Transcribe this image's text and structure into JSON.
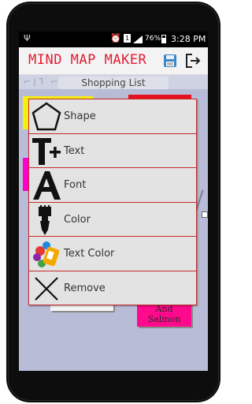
{
  "status_bar": {
    "usb_icon": "usb-icon",
    "alarm_icon": "alarm-icon",
    "sim_label": "1",
    "battery_percent": "76%",
    "time": "3:28 PM"
  },
  "header": {
    "title": "MIND MAP MAKER",
    "save_icon": "save-icon",
    "exit_icon": "exit-icon",
    "title_color": "#e21b33"
  },
  "map": {
    "list_title": "Shopping List",
    "salmon_node_text": "And\nSalmon"
  },
  "menu": {
    "items": [
      {
        "label": "Shape",
        "icon": "pentagon-icon"
      },
      {
        "label": "Text",
        "icon": "text-plus-icon"
      },
      {
        "label": "Font",
        "icon": "font-a-icon"
      },
      {
        "label": "Color",
        "icon": "paint-brush-icon"
      },
      {
        "label": "Text Color",
        "icon": "paint-bucket-icon"
      },
      {
        "label": "Remove",
        "icon": "x-icon"
      }
    ],
    "border_color": "#c62a2a"
  },
  "colors": {
    "yellow_node": "#f5ef10",
    "red_node": "#e8101e",
    "magenta_node": "#ff00cc",
    "salmon_node": "#ff0a8c",
    "canvas": "#b8bcd6"
  }
}
